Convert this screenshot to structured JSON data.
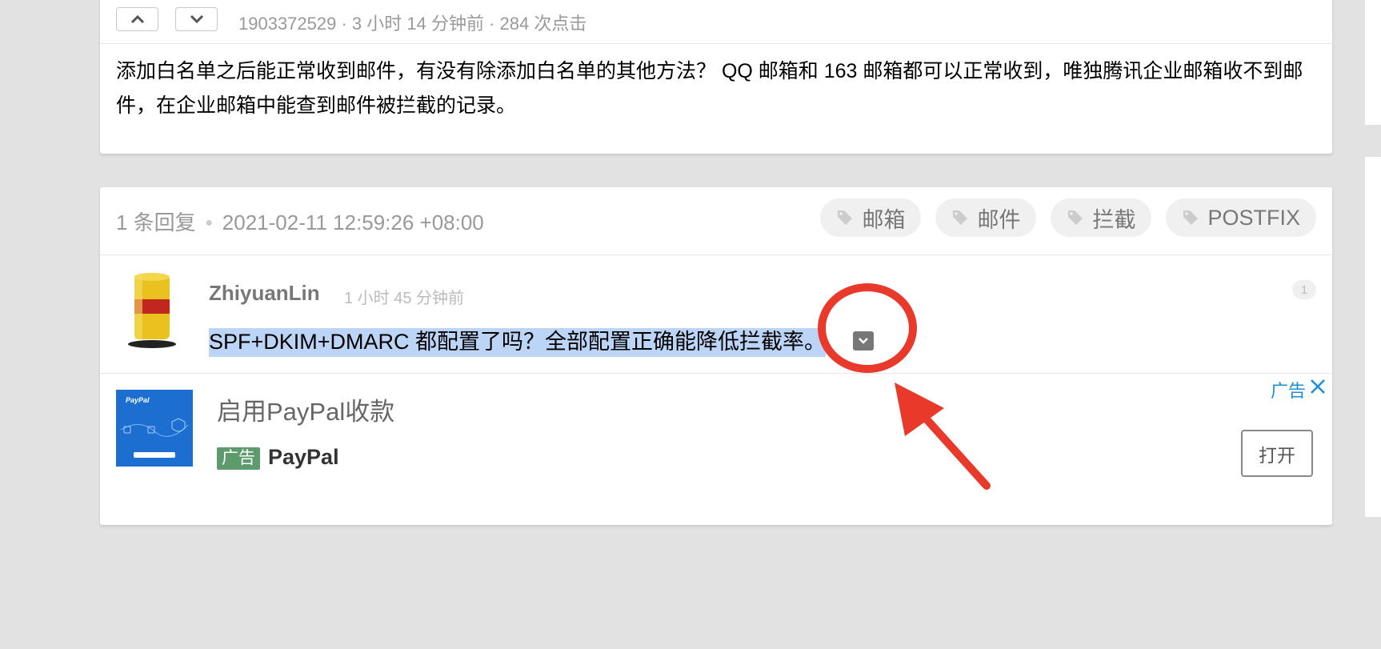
{
  "topic": {
    "meta": "1903372529 · 3 小时 14 分钟前 · 284 次点击",
    "body": "添加白名单之后能正常收到邮件，有没有除添加白名单的其他方法？ QQ 邮箱和 163 邮箱都可以正常收到，唯独腾讯企业邮箱收不到邮件，在企业邮箱中能查到邮件被拦截的记录。"
  },
  "replies": {
    "count": "1 条回复",
    "separator": "•",
    "last_time": "2021-02-11 12:59:26 +08:00",
    "tags": [
      "邮箱",
      "邮件",
      "拦截",
      "POSTFIX"
    ],
    "items": [
      {
        "user": "ZhiyuanLin",
        "time": "1 小时 45 分钟前",
        "text": "SPF+DKIM+DMARC 都配置了吗？全部配置正确能降低拦截率。",
        "number": "1"
      }
    ]
  },
  "ad": {
    "label": "广告",
    "title": "启用PayPal收款",
    "badge": "广告",
    "brand": "PayPal",
    "image_brand": "PayPal",
    "open_button": "打开"
  },
  "annotation": {
    "color": "#e8392a"
  }
}
